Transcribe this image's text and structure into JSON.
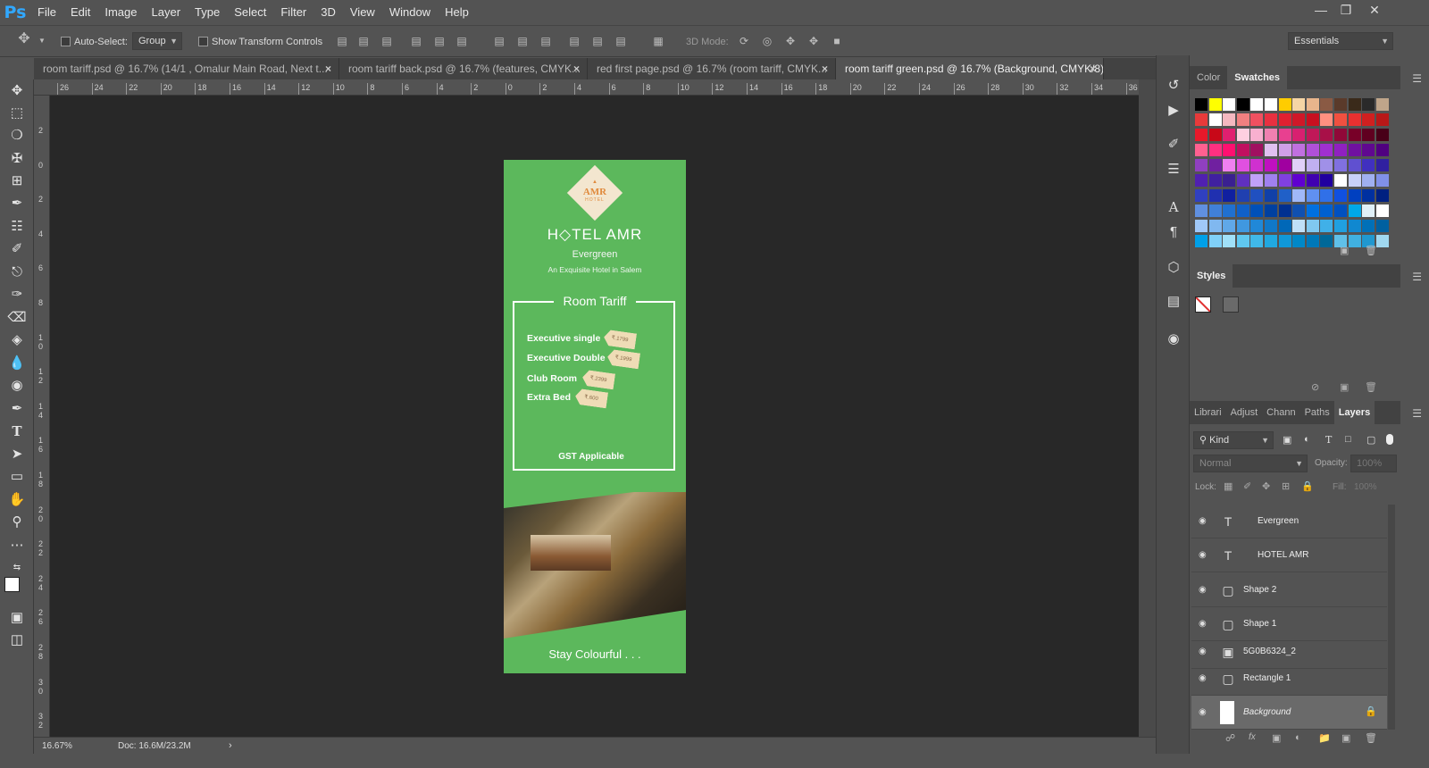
{
  "app": {
    "logo": "Ps"
  },
  "menu": [
    "File",
    "Edit",
    "Image",
    "Layer",
    "Type",
    "Select",
    "Filter",
    "3D",
    "View",
    "Window",
    "Help"
  ],
  "options": {
    "auto_select_label": "Auto-Select:",
    "auto_select_value": "Group",
    "show_transform_label": "Show Transform Controls",
    "mode3d_label": "3D Mode:",
    "workspace": "Essentials"
  },
  "tabs": [
    {
      "label": "room tariff.psd @ 16.7% (14/1 , Omalur Main Road,  Next t...",
      "active": false
    },
    {
      "label": "room tariff back.psd @ 16.7% (features, CMYK...",
      "active": false
    },
    {
      "label": "red first page.psd @ 16.7% (room tariff, CMYK...",
      "active": false
    },
    {
      "label": "room tariff green.psd @ 16.7% (Background, CMYK/8)",
      "active": true
    }
  ],
  "ruler_top": [
    "26",
    "24",
    "22",
    "20",
    "18",
    "16",
    "14",
    "12",
    "10",
    "8",
    "6",
    "4",
    "2",
    "0",
    "2",
    "4",
    "6",
    "8",
    "10",
    "12",
    "14",
    "16",
    "18",
    "20",
    "22",
    "24",
    "26",
    "28",
    "30",
    "32",
    "34",
    "36"
  ],
  "ruler_left": [
    "2",
    "0",
    "2",
    "4",
    "6",
    "8",
    "10",
    "12",
    "14",
    "16",
    "18",
    "20",
    "22",
    "24",
    "26",
    "28",
    "30",
    "32"
  ],
  "status": {
    "zoom": "16.67%",
    "doc": "Doc: 16.6M/23.2M"
  },
  "document": {
    "logo_text": "AMR",
    "logo_sub": "HOTEL",
    "hotel_name": "H◇TEL  AMR",
    "subtitle": "Evergreen",
    "tagline": "An Exquisite Hotel in Salem",
    "tariff_title": "Room Tariff",
    "rooms": [
      {
        "name": "Executive single",
        "price": "₹.1799"
      },
      {
        "name": "Executive Double",
        "price": "₹.1999"
      },
      {
        "name": "Club Room",
        "price": "₹.2399"
      },
      {
        "name": "Extra Bed",
        "price": "₹.600"
      }
    ],
    "gst": "GST Applicable",
    "footer": "Stay Colourful . . ."
  },
  "panels": {
    "color_tabs": [
      "Color",
      "Swatches"
    ],
    "styles_tab": "Styles",
    "layers_tabs": [
      "Librari",
      "Adjust",
      "Chann",
      "Paths",
      "Layers"
    ],
    "kind_label": "Kind",
    "blend_mode": "Normal",
    "opacity_label": "Opacity:",
    "opacity_value": "100%",
    "lock_label": "Lock:",
    "fill_label": "Fill:",
    "fill_value": "100%"
  },
  "layers": [
    {
      "name": "Evergreen",
      "kind": "text",
      "icon": "T"
    },
    {
      "name": "HOTEL AMR",
      "kind": "text",
      "icon": "T"
    },
    {
      "name": "Shape 2",
      "kind": "shape",
      "icon": "▢"
    },
    {
      "name": "Shape 1",
      "kind": "shape",
      "icon": "▢"
    },
    {
      "name": "5G0B6324_2",
      "kind": "smart",
      "icon": "▣"
    },
    {
      "name": "Rectangle 1",
      "kind": "shape",
      "icon": "▢"
    },
    {
      "name": "Background",
      "kind": "background",
      "icon": ""
    }
  ],
  "swatch_colors": [
    [
      "#000000",
      "#ffff00",
      "#ffffff",
      "#000000",
      "#ffffff",
      "#ffffff",
      "#ffcc00",
      "#f5d5a5",
      "#e8b58c",
      "#8a5a44",
      "#5a3a2a",
      "#3a2a1a",
      "#2a2a2a",
      "#bfa58a"
    ],
    [
      "#e83a3a",
      "#ffffff",
      "#f4b8c0",
      "#f08080",
      "#f05060",
      "#e83040",
      "#e02030",
      "#d01828",
      "#c81020",
      "#ff9080",
      "#f05040",
      "#e83030",
      "#d02020",
      "#b81818"
    ],
    [
      "#e8182a",
      "#c80818",
      "#e02070",
      "#ffd0e0",
      "#f8b0d0",
      "#f080b0",
      "#e84090",
      "#d82070",
      "#c01858",
      "#a81048",
      "#900838",
      "#780028",
      "#600020",
      "#480018"
    ],
    [
      "#ff6090",
      "#ff3080",
      "#ff1070",
      "#c01060",
      "#a01060",
      "#e0c0f0",
      "#d0a0e8",
      "#c070e0",
      "#b050d8",
      "#a030d0",
      "#9020c0",
      "#7010a0",
      "#600890",
      "#500080"
    ],
    [
      "#9040c0",
      "#7020a0",
      "#f080f0",
      "#e050e0",
      "#d030d0",
      "#c010c0",
      "#a000a0",
      "#e0d0f8",
      "#c0b0f0",
      "#a090e8",
      "#8070e0",
      "#6050d0",
      "#4030c0",
      "#3020a0"
    ],
    [
      "#5020b0",
      "#4020a0",
      "#3a2090",
      "#6030c0",
      "#c0a0f8",
      "#a080f0",
      "#8040e0",
      "#6000d0",
      "#4000b0",
      "#2000a0",
      "#ffffff",
      "#c8d0f8",
      "#a0b0f0",
      "#8090e8"
    ],
    [
      "#3040c0",
      "#2030b0",
      "#1020a0",
      "#2040b0",
      "#2050c0",
      "#1040a8",
      "#2060c8",
      "#a0b8f8",
      "#6090f0",
      "#3070e8",
      "#1050e0",
      "#0040c0",
      "#0030a0",
      "#002080"
    ],
    [
      "#6090e0",
      "#4080d8",
      "#2070d0",
      "#1060c8",
      "#0050b8",
      "#0040a0",
      "#003090",
      "#1050b0",
      "#0070e0",
      "#0060d0",
      "#0050c0",
      "#00a8e8",
      "#e0f0f8",
      "#ffffff"
    ],
    [
      "#a0c8f8",
      "#80b8f0",
      "#60a8e8",
      "#4098e0",
      "#2088d8",
      "#1078c8",
      "#0068b8",
      "#c0e0f8",
      "#80c8f0",
      "#40b0e8",
      "#20a0e0",
      "#1088d0",
      "#0070b8",
      "#0060a0"
    ],
    [
      "#00a0e8",
      "#80d0f8",
      "#a0e0f8",
      "#60c8f0",
      "#40b8e8",
      "#20a8e0",
      "#1098d8",
      "#0088c8",
      "#0078b8",
      "#006898",
      "#60c0e8",
      "#40b0e0",
      "#2098d0",
      "#a0d8f0"
    ]
  ]
}
